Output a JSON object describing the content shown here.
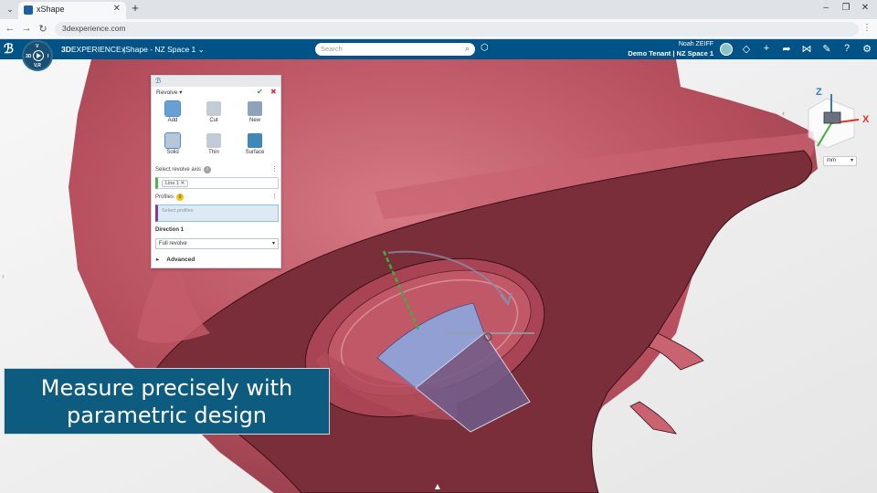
{
  "browser": {
    "tab_title": "xShape",
    "url": "3dexperience.com",
    "icons": [
      "tab-list-icon",
      "new-tab-icon",
      "minimize-icon",
      "maximize-icon",
      "close-window-icon",
      "back-icon",
      "forward-icon",
      "reload-icon",
      "kebab-menu-icon"
    ]
  },
  "header": {
    "brand_bold": "3D",
    "brand_rest": "EXPERIENCE",
    "separator": "|",
    "app_title": "xShape - NZ Space 1",
    "compass_labels": {
      "top": "V",
      "left": "3D",
      "right": "I",
      "bottom": "V,R"
    },
    "search_placeholder": "Search",
    "user_name": "Noah ZEIFF",
    "tenant": "Demo Tenant | NZ Space 1",
    "colors": {
      "header_bg": "#005386",
      "accent": "#0d5c80"
    }
  },
  "panel": {
    "command": "Revolve",
    "options": [
      {
        "label": "Add",
        "selected": true
      },
      {
        "label": "Cut",
        "selected": false
      },
      {
        "label": "New",
        "selected": false
      },
      {
        "label": "Solid",
        "selected": true
      },
      {
        "label": "Thin",
        "selected": false
      },
      {
        "label": "Surface",
        "selected": false
      }
    ],
    "axis_label": "Select revolve axis",
    "axis_info": "i",
    "axis_value": "Line 1",
    "profiles_label": "Profiles",
    "profiles_count": "0",
    "profiles_placeholder": "Select profiles",
    "direction_label": "Direction 1",
    "direction_value": "Full revolve",
    "advanced_label": "Advanced"
  },
  "viewport": {
    "unit": "mm",
    "triad": {
      "x": "X",
      "z": "Z"
    },
    "colors": {
      "body": "#b8505f",
      "body_dark": "#7a2e3a",
      "preview": "#8fa6dc",
      "axis": "#3fae3a"
    }
  },
  "caption": {
    "line1": "Measure precisely with",
    "line2": "parametric design"
  }
}
